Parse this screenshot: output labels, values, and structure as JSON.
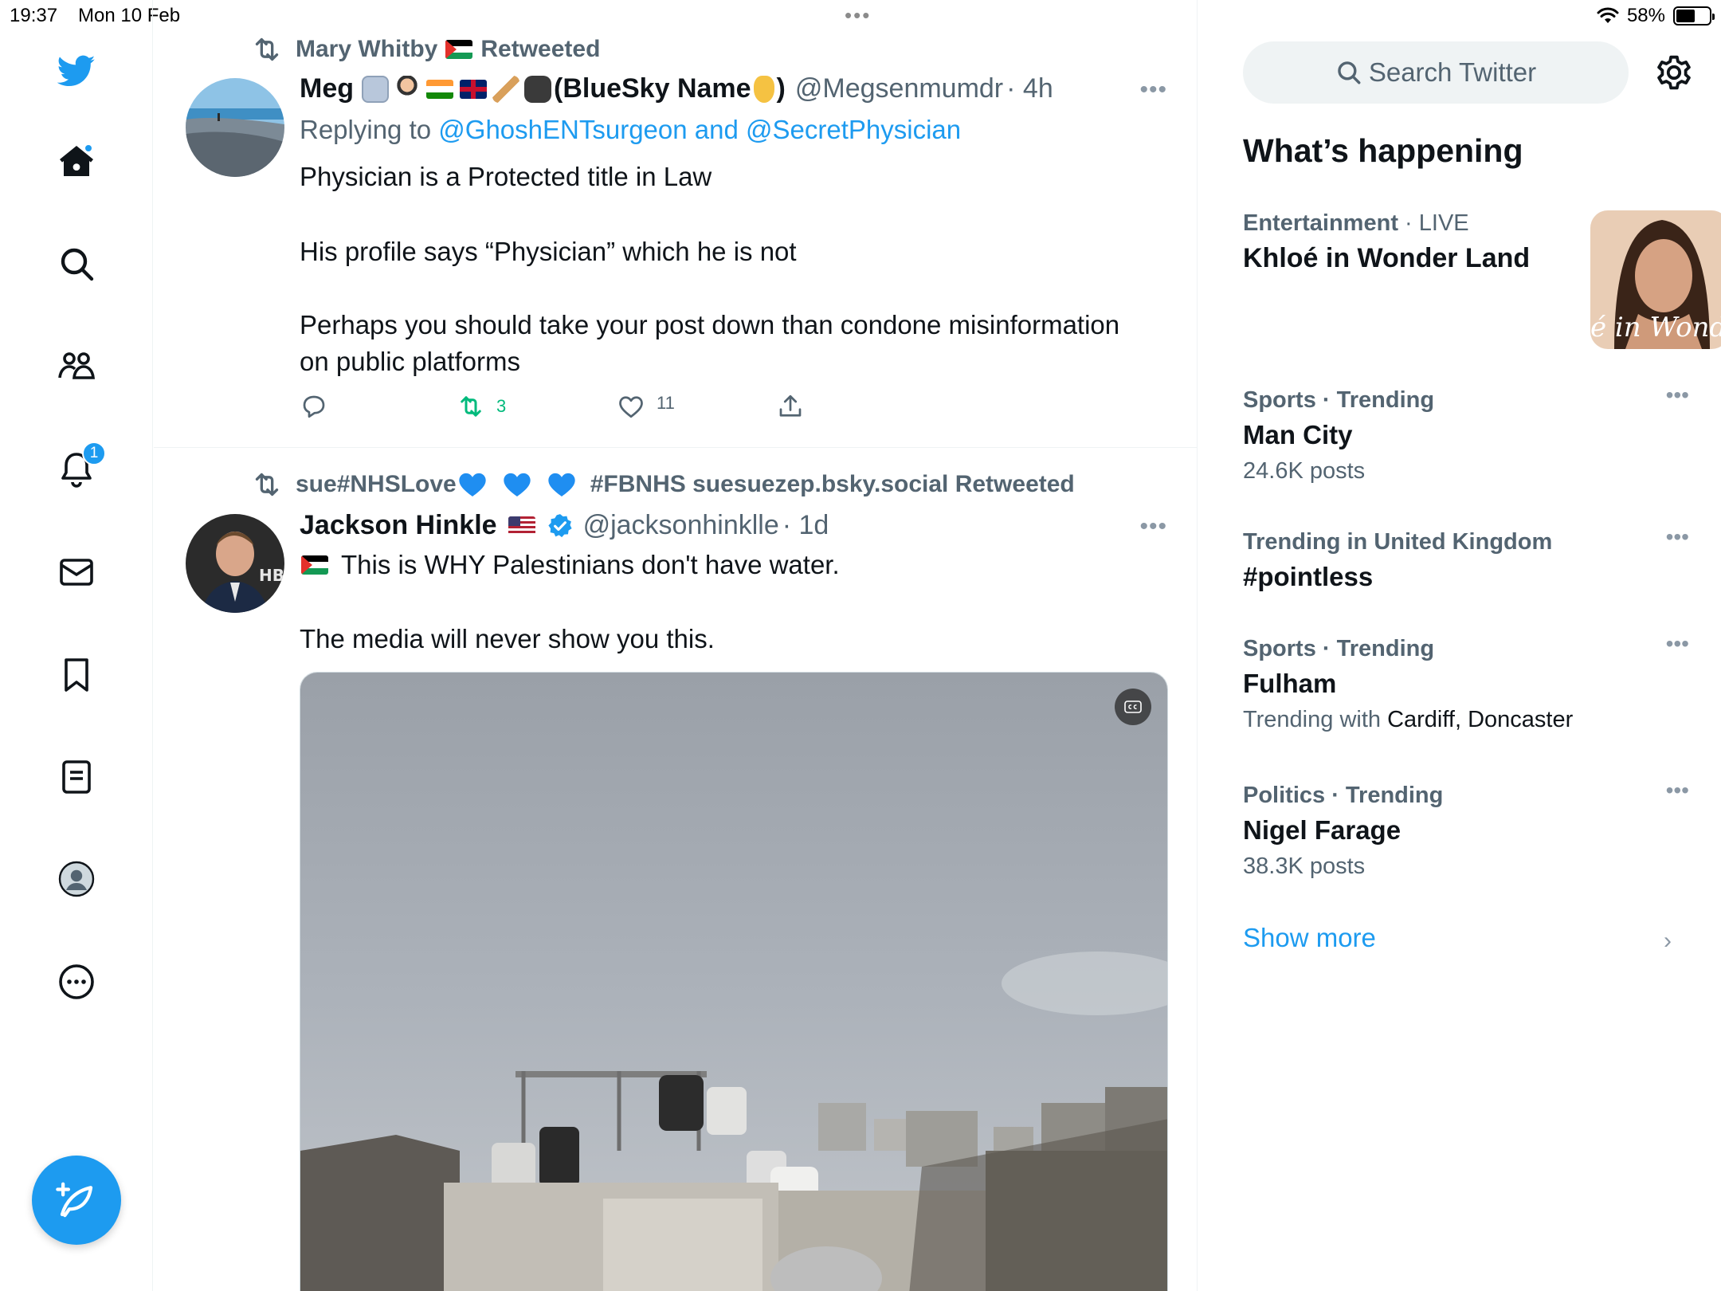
{
  "status_bar": {
    "time": "19:37",
    "date": "Mon 10 Feb",
    "battery": "58%",
    "battery_level": 0.58
  },
  "sidebar": {
    "items": [
      {
        "name": "home",
        "icon": "home-icon",
        "has_dot": true
      },
      {
        "name": "explore",
        "icon": "search-icon"
      },
      {
        "name": "communities",
        "icon": "communities-icon"
      },
      {
        "name": "notifications",
        "icon": "bell-icon",
        "badge": "1"
      },
      {
        "name": "messages",
        "icon": "mail-icon"
      },
      {
        "name": "bookmarks",
        "icon": "bookmark-icon"
      },
      {
        "name": "lists",
        "icon": "list-icon"
      },
      {
        "name": "profile",
        "icon": "profile-icon"
      },
      {
        "name": "more",
        "icon": "more-circle-icon"
      }
    ],
    "compose_icon": "compose-feather-icon"
  },
  "tweets": [
    {
      "retweeted_by": "Mary Whitby",
      "retweeted_suffix": "Retweeted",
      "name": "Meg",
      "name_suffix": "(BlueSky Name",
      "name_close": ")",
      "handle": "@Megsenmumdr",
      "time": "· 4h",
      "replying_prefix": "Replying to",
      "replying_to": "@GhoshENTsurgeon and @SecretPhysician",
      "lines": [
        "Physician is a Protected title in Law",
        "His profile says “Physician” which he is not",
        "Perhaps you should take your post down than condone misinformation",
        "on public platforms"
      ],
      "retweets": "3",
      "likes": "11"
    },
    {
      "retweeted_by": "sue#NHSLove",
      "retweeted_by_tail": "#FBNHS suesuezep.bsky.social Retweeted",
      "name": "Jackson Hinkle",
      "handle": "@jacksonhinklle",
      "time": "· 1d",
      "lines": [
        "This is WHY Palestinians don't have water.",
        "The media will never show you this."
      ]
    }
  ],
  "right": {
    "search_placeholder": "Search Twitter",
    "whats_happening": "What’s happening",
    "trends": [
      {
        "category": "Entertainment",
        "extra": "· LIVE",
        "title": "Khloé in Wonder Land",
        "thumb_text": "é in Wonder l"
      },
      {
        "category": "Sports · Trending",
        "title": "Man City",
        "sub": "24.6K posts"
      },
      {
        "category": "Trending in United Kingdom",
        "title": "#pointless"
      },
      {
        "category": "Sports · Trending",
        "title": "Fulham",
        "sub_prefix": "Trending with",
        "sub_value": "Cardiff, Doncaster"
      },
      {
        "category": "Politics · Trending",
        "title": "Nigel Farage",
        "sub": "38.3K posts"
      }
    ],
    "show_more": "Show more"
  },
  "colors": {
    "accent": "#1d9bf0",
    "retweet_green": "#00ba7c",
    "muted": "#536471"
  }
}
